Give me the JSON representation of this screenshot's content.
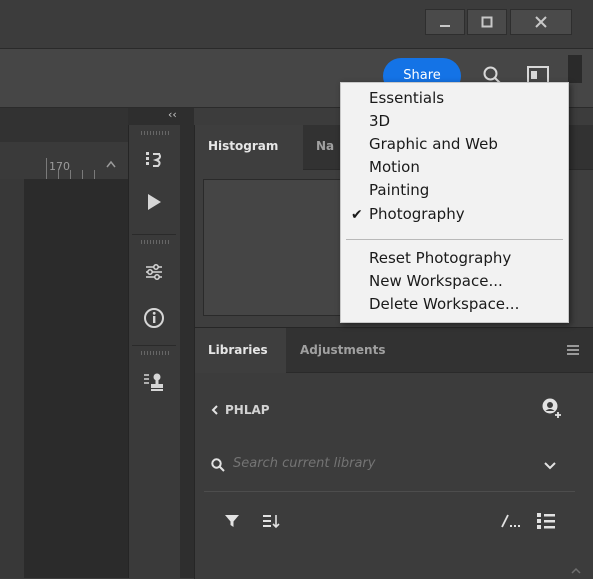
{
  "window_controls": {
    "minimize_icon": "minimize-icon",
    "maximize_icon": "maximize-icon",
    "close_icon": "close-icon"
  },
  "options_bar": {
    "share_label": "Share",
    "search_icon": "search-icon",
    "workspace_icon": "workspace-icon"
  },
  "ruler": {
    "label": "170"
  },
  "dock": {
    "collapse_glyph": "‹‹",
    "icons": [
      "history-icon",
      "play-icon",
      "properties-icon",
      "info-icon",
      "stamp-icon"
    ]
  },
  "panel_top": {
    "tabs": [
      "Histogram",
      "Na"
    ]
  },
  "libraries_panel": {
    "tabs": [
      "Libraries",
      "Adjustments"
    ],
    "menu_icon": "panel-menu-icon",
    "library_name": "PHLAP",
    "search_placeholder": "Search current library",
    "toolbar_icons": [
      "filter-icon",
      "sort-icon",
      "brush-icon",
      "list-view-icon"
    ]
  },
  "workspace_menu": {
    "items": [
      "Essentials",
      "3D",
      "Graphic and Web",
      "Motion",
      "Painting",
      "Photography"
    ],
    "checked_item": "Photography",
    "check_glyph": "✔",
    "actions": [
      "Reset Photography",
      "New Workspace...",
      "Delete Workspace..."
    ]
  },
  "colors": {
    "accent": "#1473e6",
    "panel_bg": "#3c3c3c",
    "menu_bg": "#f2f2f2"
  }
}
